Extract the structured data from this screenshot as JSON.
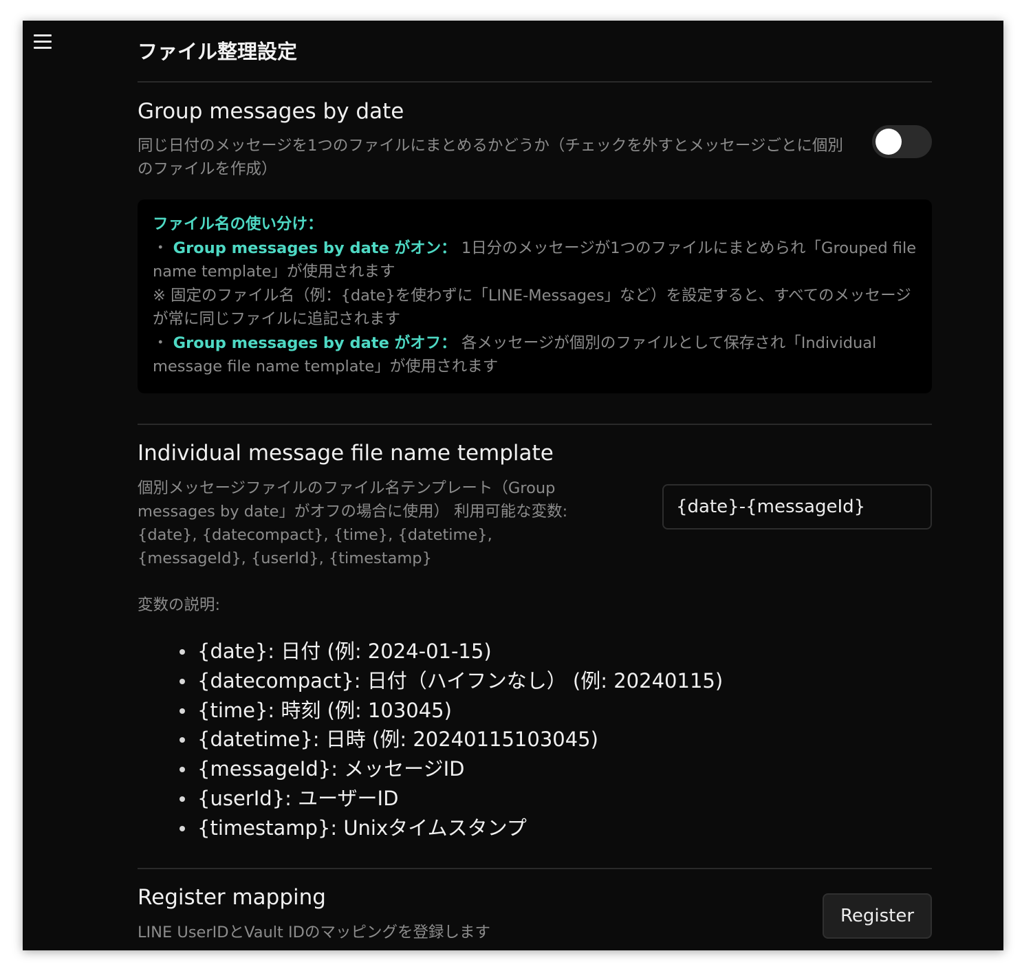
{
  "page": {
    "title": "ファイル整理設定"
  },
  "group_by_date": {
    "name": "Group messages by date",
    "desc": "同じ日付のメッセージを1つのファイルにまとめるかどうか（チェックを外すとメッセージごとに個別のファイルを作成）",
    "enabled": false
  },
  "info": {
    "title": "ファイル名の使い分け：",
    "on_bullet": "・",
    "on_label": "Group messages by date がオン：",
    "on_text": " 1日分のメッセージが1つのファイルにまとめられ「Grouped file name template」が使用されます",
    "note": "※ 固定のファイル名（例：{date}を使わずに「LINE-Messages」など）を設定すると、すべてのメッセージが常に同じファイルに追記されます",
    "off_bullet": "・",
    "off_label": "Group messages by date がオフ：",
    "off_text": " 各メッセージが個別のファイルとして保存され「Individual message file name template」が使用されます"
  },
  "individual_template": {
    "name": "Individual message file name template",
    "desc": "個別メッセージファイルのファイル名テンプレート（Group messages by date」がオフの場合に使用） 利用可能な変数: {date}, {datecompact}, {time}, {datetime}, {messageId}, {userId}, {timestamp}",
    "vars_heading": "変数の説明:",
    "value": "{date}-{messageId}",
    "variables": [
      "{date}: 日付 (例: 2024-01-15)",
      "{datecompact}: 日付（ハイフンなし） (例: 20240115)",
      "{time}: 時刻 (例: 103045)",
      "{datetime}: 日時 (例: 20240115103045)",
      "{messageId}: メッセージID",
      "{userId}: ユーザーID",
      "{timestamp}: Unixタイムスタンプ"
    ]
  },
  "register": {
    "name": "Register mapping",
    "desc": "LINE UserIDとVault IDのマッピングを登録します",
    "button_label": "Register"
  }
}
